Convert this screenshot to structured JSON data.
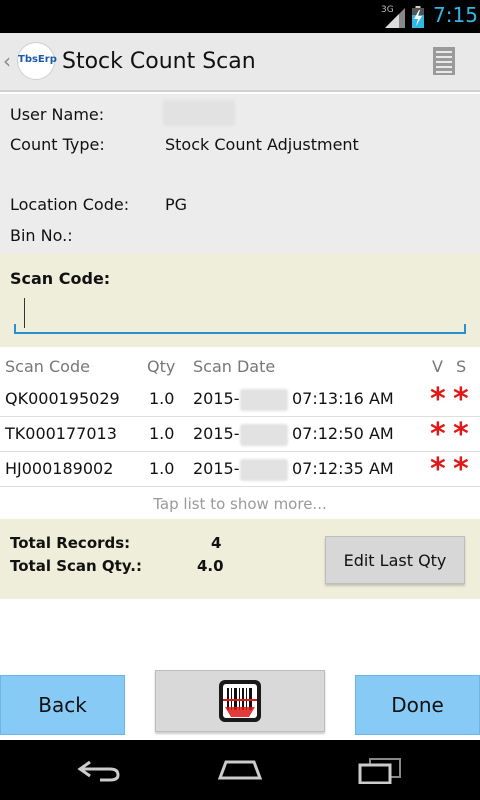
{
  "status_bar": {
    "network": "3G",
    "time": "7:15"
  },
  "action_bar": {
    "logo_text": "TbsErp",
    "title": "Stock Count Scan"
  },
  "info": {
    "user_name_label": "User Name:",
    "user_name_value": "",
    "count_type_label": "Count Type:",
    "count_type_value": "Stock Count Adjustment",
    "location_code_label": "Location Code:",
    "location_code_value": "PG",
    "bin_no_label": "Bin No.:",
    "bin_no_value": ""
  },
  "scan": {
    "label": "Scan Code:",
    "value": "",
    "placeholder": ""
  },
  "list": {
    "headers": {
      "scan_code": "Scan Code",
      "qty": "Qty",
      "scan_date": "Scan Date",
      "v": "V",
      "s": "S"
    },
    "rows": [
      {
        "scan_code": "QK000195029",
        "qty": "1.0",
        "date_prefix": "2015-",
        "time": "07:13:16 AM",
        "v": "*",
        "s": "*"
      },
      {
        "scan_code": "TK000177013",
        "qty": "1.0",
        "date_prefix": "2015-",
        "time": "07:12:50 AM",
        "v": "*",
        "s": "*"
      },
      {
        "scan_code": "HJ000189002",
        "qty": "1.0",
        "date_prefix": "2015-",
        "time": "07:12:35 AM",
        "v": "*",
        "s": "*"
      }
    ],
    "more_text": "Tap list to show more..."
  },
  "totals": {
    "records_label": "Total Records:",
    "records_value": "4",
    "scan_qty_label": "Total Scan Qty.:",
    "scan_qty_value": "4.0",
    "edit_last_qty_label": "Edit Last Qty"
  },
  "buttons": {
    "back": "Back",
    "done": "Done",
    "scan_icon": "barcode-scanner-icon"
  },
  "colors": {
    "accent_blue": "#33b5e5",
    "button_blue": "#87caf6",
    "panel_beige": "#eeeeda",
    "marker_red": "#e01818"
  }
}
